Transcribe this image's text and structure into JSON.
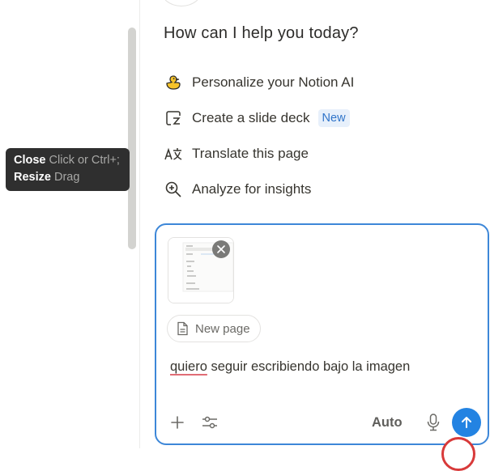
{
  "tooltip": {
    "close_key": "Close",
    "close_hint": "Click or Ctrl+;",
    "resize_key": "Resize",
    "resize_hint": "Drag"
  },
  "assistant": {
    "heading": "How can I help you today?",
    "suggestions": [
      {
        "label": "Personalize your Notion AI",
        "icon": "duck-icon"
      },
      {
        "label": "Create a slide deck",
        "icon": "slide-deck-icon",
        "badge": "New"
      },
      {
        "label": "Translate this page",
        "icon": "translate-icon"
      },
      {
        "label": "Analyze for insights",
        "icon": "zoom-insights-icon"
      }
    ]
  },
  "composer": {
    "attachment_chip": "New page",
    "text_misspelled": "quiero",
    "text_rest": " seguir escribiendo bajo la imagen",
    "mode_label": "Auto",
    "accent_color": "#2383e2"
  }
}
